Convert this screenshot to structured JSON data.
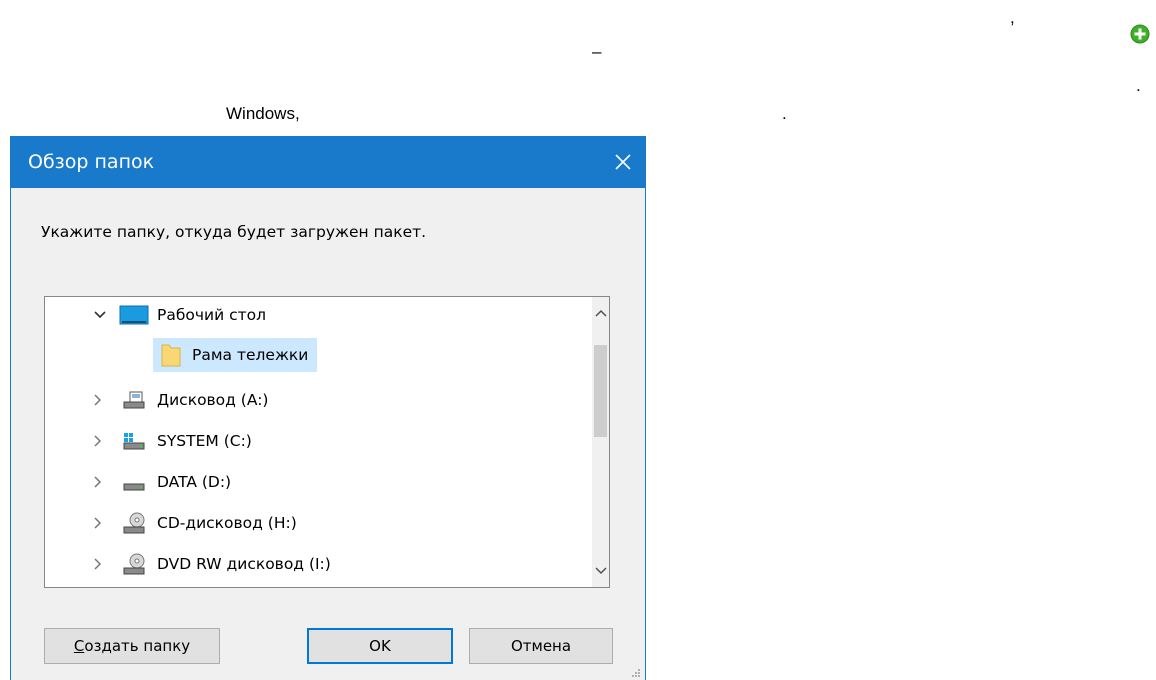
{
  "document": {
    "comma": ",",
    "dash": "–",
    "dot1": ".",
    "windows": "Windows,",
    "dot2": "."
  },
  "dialog": {
    "title": "Обзор папок",
    "close_label": "✕",
    "prompt": "Укажите папку, откуда будет загружен пакет.",
    "tree": [
      {
        "label": "Рабочий стол",
        "icon": "desktop-icon",
        "expanded": true
      },
      {
        "label": "Рама тележки",
        "icon": "folder-icon",
        "selected": true
      },
      {
        "label": "Дисковод (A:)",
        "icon": "floppy-drive-icon"
      },
      {
        "label": "SYSTEM (C:)",
        "icon": "system-drive-icon"
      },
      {
        "label": "DATA (D:)",
        "icon": "hard-drive-icon"
      },
      {
        "label": "CD-дисковод (H:)",
        "icon": "cd-drive-icon"
      },
      {
        "label": "DVD RW дисковод (I:)",
        "icon": "dvd-drive-icon"
      }
    ],
    "buttons": {
      "new_folder_underlined": "С",
      "new_folder_rest": "оздать папку",
      "ok": "OK",
      "cancel": "Отмена"
    }
  },
  "colors": {
    "titlebar": "#1979ca",
    "selection": "#cce8ff",
    "plus_icon": "#3fae29"
  }
}
